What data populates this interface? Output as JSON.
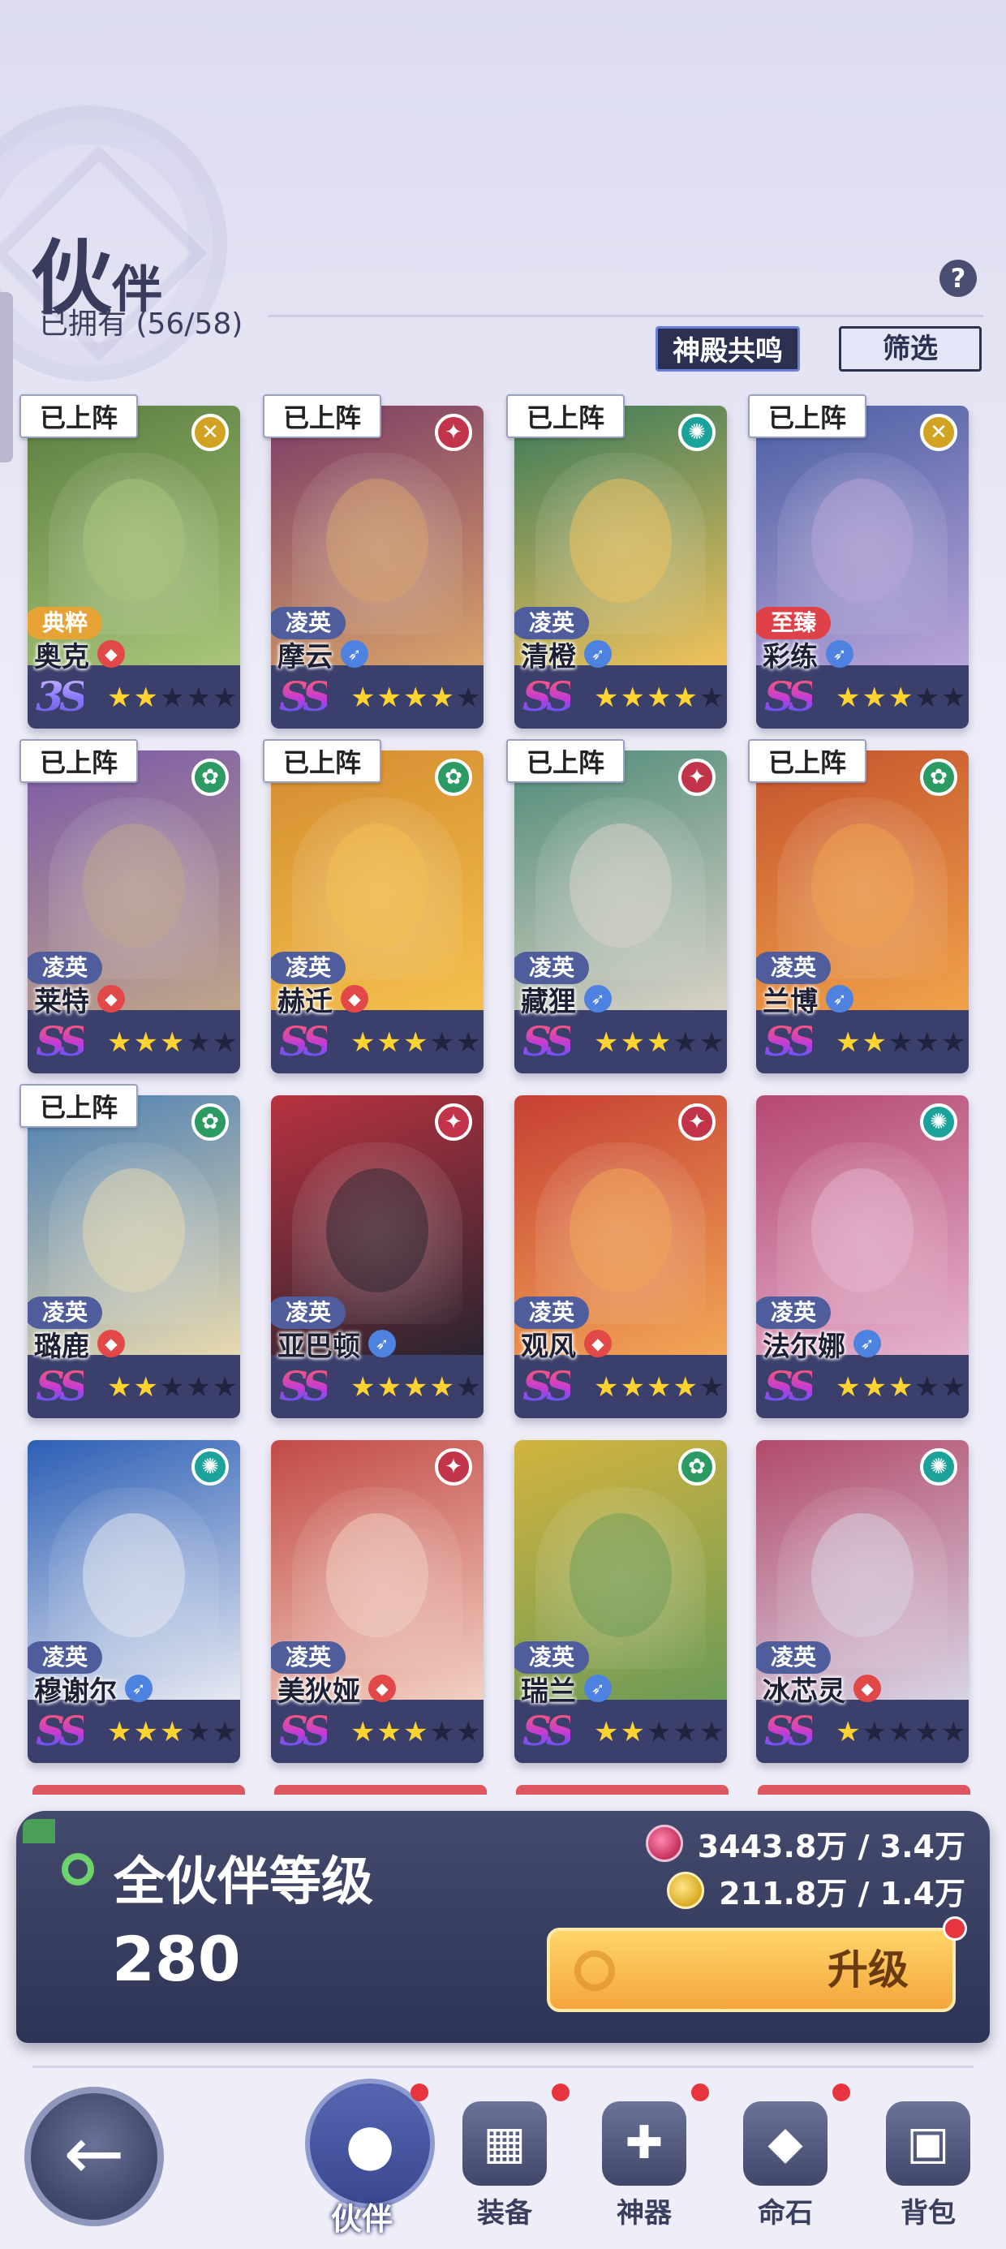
{
  "header": {
    "title_big": "伙",
    "title_small": "伴",
    "owned": "已拥有 (56/58)",
    "help": "?",
    "resonance_button": "神殿共鸣",
    "filter_button": "筛选"
  },
  "deployed_label": "已上阵",
  "partners": [
    {
      "name": "奥克",
      "rarity": "典粹",
      "grade": "3S",
      "stars": 2,
      "element": "gold",
      "class": "red",
      "deployed": true
    },
    {
      "name": "摩云",
      "rarity": "凌英",
      "grade": "SS",
      "stars": 4,
      "element": "red",
      "class": "blue",
      "deployed": true
    },
    {
      "name": "清橙",
      "rarity": "凌英",
      "grade": "SS",
      "stars": 4,
      "element": "teal",
      "class": "blue",
      "deployed": true
    },
    {
      "name": "彩练",
      "rarity": "至臻",
      "grade": "SS",
      "stars": 3,
      "element": "gold",
      "class": "blue",
      "deployed": true
    },
    {
      "name": "莱特",
      "rarity": "凌英",
      "grade": "SS",
      "stars": 3,
      "element": "green",
      "class": "red",
      "deployed": true
    },
    {
      "name": "赫迁",
      "rarity": "凌英",
      "grade": "SS",
      "stars": 3,
      "element": "green",
      "class": "red",
      "deployed": true
    },
    {
      "name": "藏狸",
      "rarity": "凌英",
      "grade": "SS",
      "stars": 3,
      "element": "red",
      "class": "blue",
      "deployed": true
    },
    {
      "name": "兰博",
      "rarity": "凌英",
      "grade": "SS",
      "stars": 2,
      "element": "green",
      "class": "blue",
      "deployed": true
    },
    {
      "name": "璐鹿",
      "rarity": "凌英",
      "grade": "SS",
      "stars": 2,
      "element": "green",
      "class": "red",
      "deployed": true
    },
    {
      "name": "亚巴顿",
      "rarity": "凌英",
      "grade": "SS",
      "stars": 4,
      "element": "red",
      "class": "blue",
      "deployed": false
    },
    {
      "name": "观风",
      "rarity": "凌英",
      "grade": "SS",
      "stars": 4,
      "element": "red",
      "class": "red",
      "deployed": false
    },
    {
      "name": "法尔娜",
      "rarity": "凌英",
      "grade": "SS",
      "stars": 3,
      "element": "teal",
      "class": "blue",
      "deployed": false
    },
    {
      "name": "穆谢尔",
      "rarity": "凌英",
      "grade": "SS",
      "stars": 3,
      "element": "teal",
      "class": "blue",
      "deployed": false
    },
    {
      "name": "美狄娅",
      "rarity": "凌英",
      "grade": "SS",
      "stars": 3,
      "element": "red",
      "class": "red",
      "deployed": false
    },
    {
      "name": "瑞兰",
      "rarity": "凌英",
      "grade": "SS",
      "stars": 2,
      "element": "green",
      "class": "blue",
      "deployed": false
    },
    {
      "name": "冰芯灵",
      "rarity": "凌英",
      "grade": "SS",
      "stars": 1,
      "element": "teal",
      "class": "red",
      "deployed": false
    }
  ],
  "level_panel": {
    "title": "全伙伴等级",
    "level": "280",
    "exp": "3443.8万 / 3.4万",
    "gold": "211.8万 / 1.4万",
    "upgrade_button": "升级"
  },
  "nav": {
    "back": "back-arrow",
    "items": [
      {
        "label": "伙伴",
        "icon": "helmet-icon",
        "active": true
      },
      {
        "label": "装备",
        "icon": "armor-icon",
        "active": false
      },
      {
        "label": "神器",
        "icon": "artifact-icon",
        "active": false
      },
      {
        "label": "命石",
        "icon": "stone-icon",
        "active": false
      },
      {
        "label": "背包",
        "icon": "backpack-icon",
        "active": false
      }
    ]
  },
  "colors": {
    "panel": "#2e3455",
    "star_on": "#ffd330",
    "rarity_common": "#4f5d9c",
    "rarity_gold": "#e7a235",
    "rarity_red": "#de4148"
  }
}
